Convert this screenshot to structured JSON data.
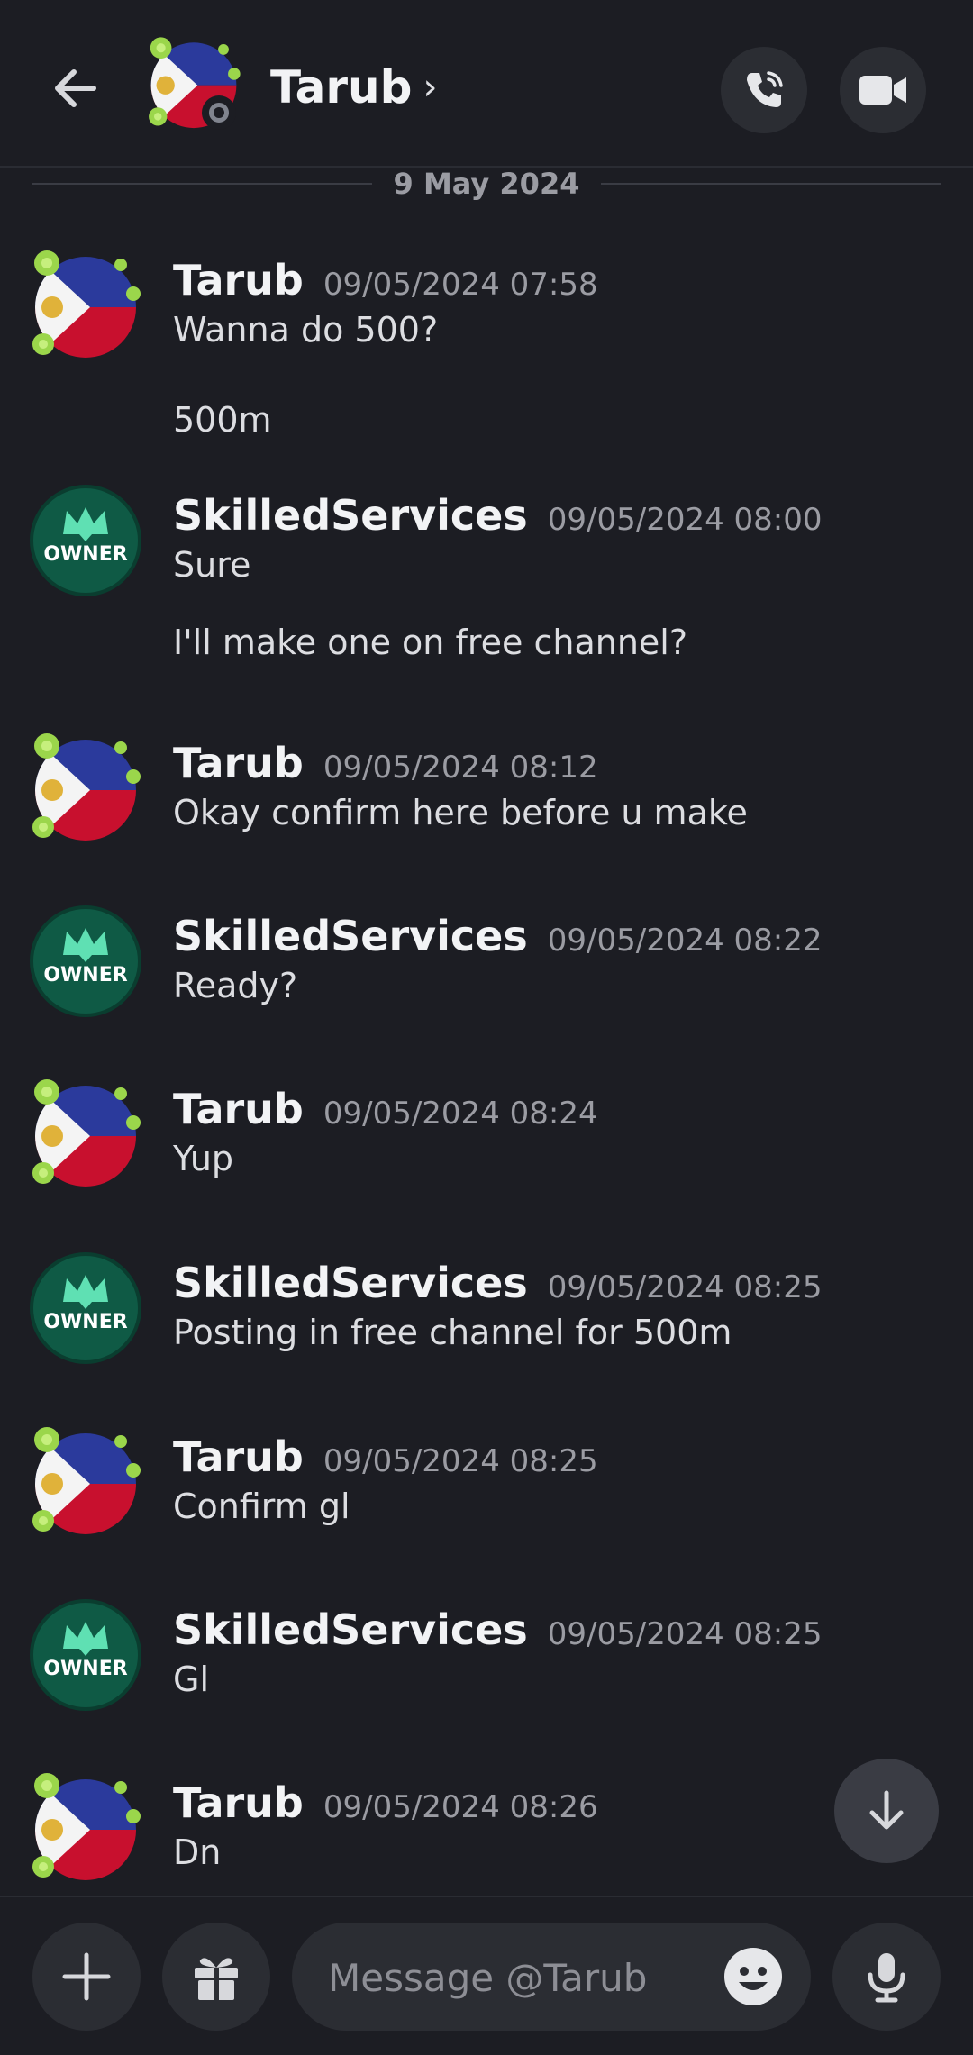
{
  "header": {
    "title": "Tarub",
    "chevron": "›",
    "icons": {
      "back": "arrow-left-icon",
      "call": "phone-icon",
      "video": "video-camera-icon"
    }
  },
  "date_divider": "9 May 2024",
  "messages": [
    {
      "author": "Tarub",
      "time": "09/05/2024 07:58",
      "avatar": "flag",
      "lines": [
        "Wanna do 500?",
        "500m"
      ]
    },
    {
      "author": "SkilledServices",
      "time": "09/05/2024 08:00",
      "avatar": "owner",
      "lines": [
        "Sure",
        "I'll make one on free channel?"
      ]
    },
    {
      "author": "Tarub",
      "time": "09/05/2024 08:12",
      "avatar": "flag",
      "lines": [
        "Okay confirm here before u make"
      ]
    },
    {
      "author": "SkilledServices",
      "time": "09/05/2024 08:22",
      "avatar": "owner",
      "lines": [
        "Ready?"
      ]
    },
    {
      "author": "Tarub",
      "time": "09/05/2024 08:24",
      "avatar": "flag",
      "lines": [
        "Yup"
      ]
    },
    {
      "author": "SkilledServices",
      "time": "09/05/2024 08:25",
      "avatar": "owner",
      "lines": [
        "Posting in free channel for 500m"
      ]
    },
    {
      "author": "Tarub",
      "time": "09/05/2024 08:25",
      "avatar": "flag",
      "lines": [
        "Confirm gl"
      ]
    },
    {
      "author": "SkilledServices",
      "time": "09/05/2024 08:25",
      "avatar": "owner",
      "lines": [
        "Gl"
      ]
    },
    {
      "author": "Tarub",
      "time": "09/05/2024 08:26",
      "avatar": "flag",
      "lines": [
        "Dn"
      ]
    }
  ],
  "owner_badge_text": "OWNER",
  "composer": {
    "placeholder": "Message @Tarub",
    "icons": {
      "add": "plus-icon",
      "gift": "gift-icon",
      "emoji": "emoji-icon",
      "mic": "microphone-icon"
    }
  },
  "scroll_down_icon": "arrow-down-icon",
  "colors": {
    "background": "#1c1d23",
    "button_bg": "#2b2d33",
    "timestamp": "#9b9ca3",
    "owner_green": "#0f5a45"
  }
}
